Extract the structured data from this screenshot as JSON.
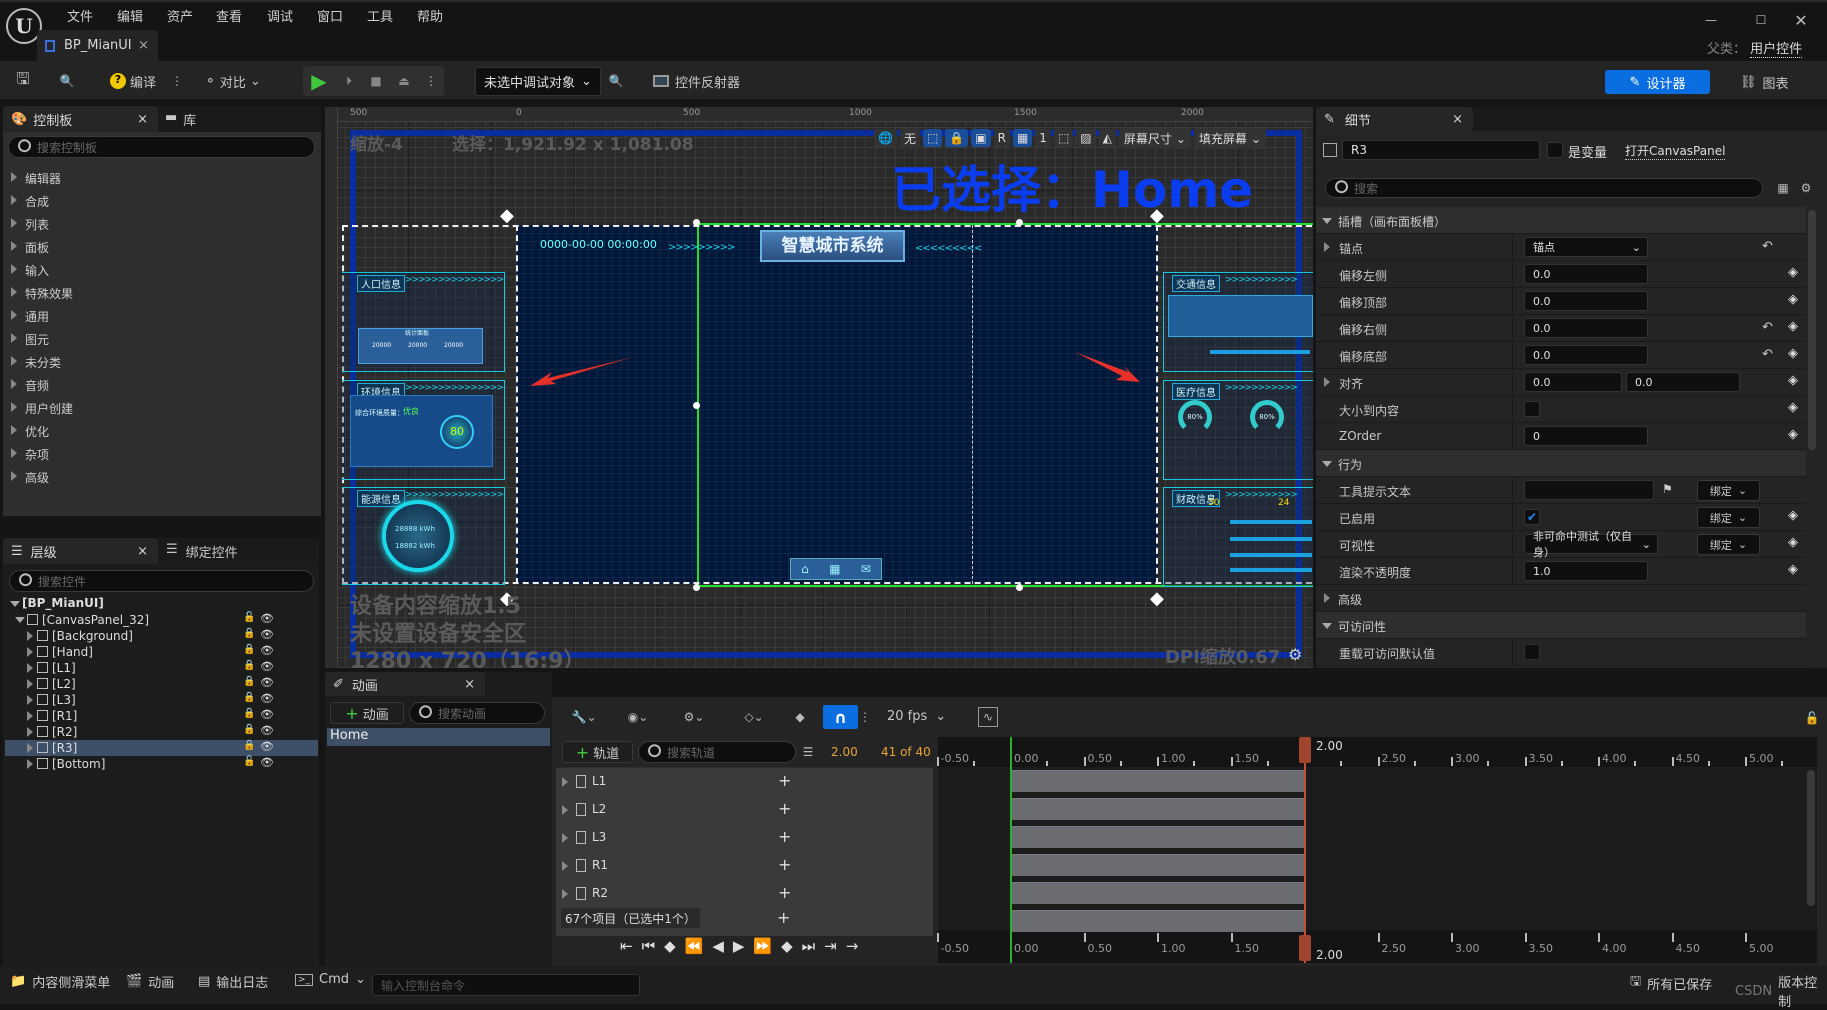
{
  "menu": [
    "文件",
    "编辑",
    "资产",
    "查看",
    "调试",
    "窗口",
    "工具",
    "帮助"
  ],
  "doc_tab": "BP_MianUI",
  "parent_class": {
    "label": "父类：",
    "value": "用户控件"
  },
  "toolbar": {
    "compile": "编译",
    "diff": "对比",
    "debug_target": "未选中调试对象",
    "widget_reflector": "控件反射器",
    "designer": "设计器",
    "graph": "图表"
  },
  "palette": {
    "tab": "控制板",
    "library_tab": "库",
    "search_placeholder": "搜索控制板",
    "items": [
      "编辑器",
      "合成",
      "列表",
      "面板",
      "输入",
      "特殊效果",
      "通用",
      "图元",
      "未分类",
      "音频",
      "用户创建",
      "优化",
      "杂项",
      "高级"
    ]
  },
  "hierarchy": {
    "tab": "层级",
    "bind_tab": "绑定控件",
    "search_placeholder": "搜索控件",
    "root": "[BP_MianUI]",
    "canvas": "[CanvasPanel_32]",
    "items": [
      "[Background]",
      "[Hand]",
      "[L1]",
      "[L2]",
      "[L3]",
      "[R1]",
      "[R2]",
      "[R3]",
      "[Bottom]"
    ],
    "selected": "[R3]"
  },
  "viewport": {
    "ruler": [
      "500",
      "0",
      "500",
      "1000",
      "1500",
      "2000"
    ],
    "zoom": "缩放-4",
    "selection": "选择：1,921.92 x 1,081.08",
    "toolbar": {
      "world": "无",
      "r": "R",
      "grid": "1",
      "screen_size": "屏幕尺寸",
      "fill": "填充屏幕"
    },
    "selected_label": "已选择：Home",
    "device_scale": "设备内容缩放1.5",
    "safe_zone": "未设置设备安全区",
    "resolution": "1280 x 720（16:9）",
    "dpi": "DPI缩放0.67",
    "design": {
      "title": "智慧城市系统",
      "datetime": "0000-00-00   00:00:00",
      "left_panels": [
        "人口信息",
        "环境信息",
        "能源信息"
      ],
      "right_panels": [
        "交通信息",
        "医疗信息",
        "财政信息"
      ],
      "env_quality": "综合环境质量：",
      "env_grade": "优良",
      "env_score": "80",
      "stat": "统计面板",
      "stat_values": [
        "20000",
        "20000",
        "20000"
      ],
      "energy_values": [
        "28888 kWh",
        "18882 kWh"
      ],
      "medical_pct": [
        "80%",
        "80%"
      ],
      "finance_values": [
        "30",
        "24"
      ]
    },
    "arrow_color": "#e8302a",
    "frame_color": "#0a2ea0",
    "selected_color": "#0a3cf0"
  },
  "details": {
    "tab": "细节",
    "name": "R3",
    "is_variable": "是变量",
    "open": "打开CanvasPanel",
    "search_placeholder": "搜索",
    "rows": [
      {
        "type": "section",
        "label": "插槽（画布面板槽）"
      },
      {
        "label": "锚点",
        "expand": true,
        "dropdown": "锚点",
        "revert": true
      },
      {
        "label": "偏移左侧",
        "value": "0.0",
        "pin": true
      },
      {
        "label": "偏移顶部",
        "value": "0.0",
        "pin": true
      },
      {
        "label": "偏移右侧",
        "value": "0.0",
        "revert": true,
        "pin": true
      },
      {
        "label": "偏移底部",
        "value": "0.0",
        "revert": true,
        "pin": true
      },
      {
        "label": "对齐",
        "expand": true,
        "value": "0.0",
        "value2": "0.0",
        "pin": true
      },
      {
        "label": "大小到内容",
        "checkbox": false,
        "pin": true
      },
      {
        "label": "ZOrder",
        "value": "0",
        "pin": true
      },
      {
        "type": "section",
        "label": "行为"
      },
      {
        "label": "工具提示文本",
        "value": "",
        "flag": true,
        "bind": "绑定"
      },
      {
        "label": "已启用",
        "checkbox": true,
        "bind": "绑定",
        "pin": true
      },
      {
        "label": "可视性",
        "dropdown": "非可命中测试（仅自身）",
        "bind": "绑定",
        "pin": true
      },
      {
        "label": "渲染不透明度",
        "value": "1.0",
        "pin": true
      },
      {
        "type": "subsection",
        "label": "高级"
      },
      {
        "type": "section",
        "label": "可访问性"
      },
      {
        "label": "重载可访问默认值",
        "checkbox": false
      }
    ]
  },
  "animations": {
    "tab": "动画",
    "add": "动画",
    "search_placeholder": "搜索动画",
    "items": [
      "Home"
    ]
  },
  "sequencer": {
    "fps": "20 fps",
    "add_track": "轨道",
    "search_placeholder": "搜索轨道",
    "current_time": "2.00",
    "frames": "41 of 40",
    "tracks": [
      "L1",
      "L2",
      "L3",
      "R1",
      "R2"
    ],
    "status": "67个项目（已选中1个）",
    "ticks": [
      "-0.50",
      "0.00",
      "0.50",
      "1.00",
      "1.50",
      "2.00",
      "2.50",
      "3.00",
      "3.50",
      "4.00",
      "4.50",
      "5.00"
    ],
    "tick_values": [
      -0.5,
      0,
      0.5,
      1,
      1.5,
      2,
      2.5,
      3,
      3.5,
      4,
      4.5,
      5
    ],
    "playhead": "2.00",
    "playhead_value": 2.0,
    "end_value": 2.0,
    "accent": "#0070e0",
    "orange": "#e8a33a"
  },
  "statusbar": {
    "content_drawer": "内容侧滑菜单",
    "anim": "动画",
    "output_log": "输出日志",
    "cmd": "Cmd",
    "cmd_placeholder": "输入控制台命令",
    "saved": "所有已保存",
    "source_control": "版本控制",
    "watermark": "CSDN"
  }
}
